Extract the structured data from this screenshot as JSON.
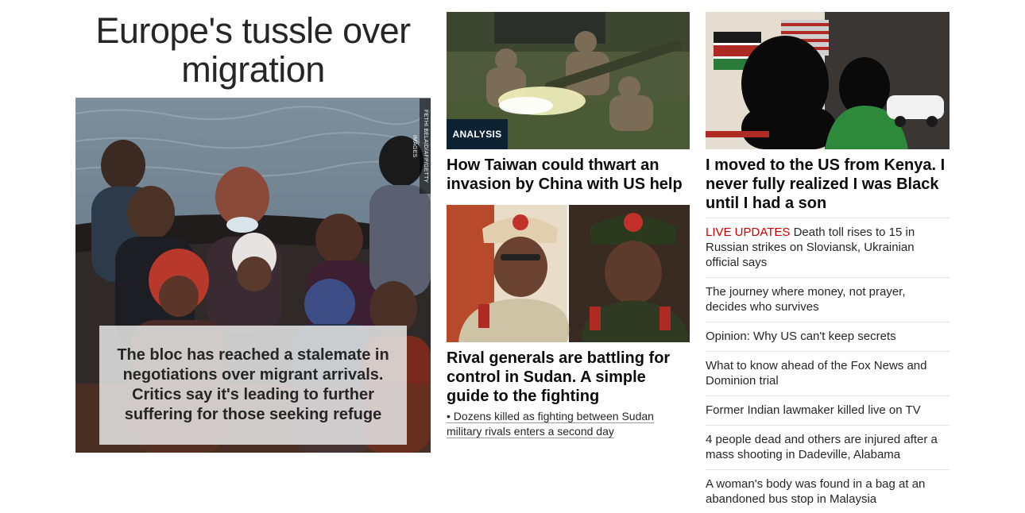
{
  "lead": {
    "title": "Europe's tussle over migration",
    "photo_credit": "FETHI BELAID/AFP/GETTY IMAGES",
    "overlay_text": "The bloc has reached a stalemate in negotiations over migrant arrivals. Critics say it's leading to further suffering for those seeking refuge"
  },
  "taiwan": {
    "badge": "ANALYSIS",
    "headline": "How Taiwan could thwart an invasion by China with US help"
  },
  "sudan": {
    "headline": "Rival generals are battling for control in Sudan. A simple guide to the fighting",
    "related": "• Dozens killed as fighting between Sudan military rivals enters a second day"
  },
  "kenya": {
    "headline": "I moved to the US from Kenya. I never fully realized I was Black until I had a son"
  },
  "list": [
    {
      "label": "LIVE UPDATES",
      "text": " Death toll rises to 15 in Russian strikes on Sloviansk, Ukrainian official says"
    },
    {
      "label": "",
      "text": "The journey where money, not prayer, decides who survives"
    },
    {
      "label": "",
      "text": "Opinion: Why US can't keep secrets"
    },
    {
      "label": "",
      "text": "What to know ahead of the Fox News and Dominion trial"
    },
    {
      "label": "",
      "text": "Former Indian lawmaker killed live on TV"
    },
    {
      "label": "",
      "text": "4 people dead and others are injured after a mass shooting in Dadeville, Alabama"
    },
    {
      "label": "",
      "text": "A woman's body was found in a bag at an abandoned bus stop in Malaysia"
    }
  ],
  "colors": {
    "live_label": "#cc0000",
    "analysis_badge": "#0c2233"
  }
}
